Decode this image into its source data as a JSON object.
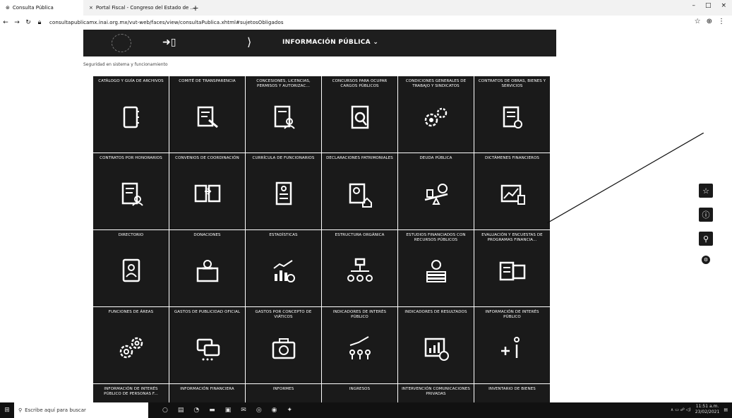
{
  "browser": {
    "tabs": [
      {
        "title": "Consulta Pública",
        "active": true
      },
      {
        "title": "Portal Fiscal - Congreso del Estado de ...",
        "active": false
      }
    ],
    "new_tab": "+",
    "url": "consultapublicamx.inai.org.mx/vut-web/faces/view/consultaPublica.xhtml#sujetosObligados",
    "window_controls": [
      "–",
      "□",
      "×"
    ],
    "address_actions": [
      "☆",
      "⊕",
      "⋮"
    ]
  },
  "site": {
    "menu_label": "INFORMACIÓN PÚBLICA ⌄",
    "breadcrumb": "Seguridad en sistema y funcionamiento"
  },
  "tiles": [
    {
      "title": "CATÁLOGO Y GUÍA DE ARCHIVOS",
      "icon": "notebook-icon"
    },
    {
      "title": "COMITÉ DE TRANSPARENCIA",
      "icon": "gavel-document-icon"
    },
    {
      "title": "CONCESIONES, LICENCIAS, PERMISOS Y AUTORIZAC...",
      "icon": "document-person-icon"
    },
    {
      "title": "CONCURSOS PARA OCUPAR CARGOS PÚBLICOS",
      "icon": "document-search-icon"
    },
    {
      "title": "CONDICIONES GENERALES DE TRABAJO Y SINDICATOS",
      "icon": "gears-people-icon"
    },
    {
      "title": "CONTRATOS DE OBRAS, BIENES Y SERVICIOS",
      "icon": "contract-check-icon"
    },
    {
      "title": "CONTRATOS POR HONORARIOS",
      "icon": "document-user-icon"
    },
    {
      "title": "CONVENIOS DE COORDINACIÓN",
      "icon": "exchange-documents-icon"
    },
    {
      "title": "CURRÍCULA DE FUNCIONARIOS",
      "icon": "resume-icon"
    },
    {
      "title": "DECLARACIONES PATRIMONIALES",
      "icon": "declaration-home-icon"
    },
    {
      "title": "DEUDA PÚBLICA",
      "icon": "balance-money-icon"
    },
    {
      "title": "DICTÁMENES FINANCIEROS",
      "icon": "financial-chart-icon"
    },
    {
      "title": "DIRECTORIO",
      "icon": "address-book-icon"
    },
    {
      "title": "DONACIONES",
      "icon": "donation-box-icon"
    },
    {
      "title": "ESTADÍSTICAS",
      "icon": "statistics-icon"
    },
    {
      "title": "ESTRUCTURA ORGÁNICA",
      "icon": "org-chart-icon"
    },
    {
      "title": "ESTUDIOS FINANCIADOS CON RECURSOS PÚBLICOS",
      "icon": "money-books-icon"
    },
    {
      "title": "EVALUACIÓN Y ENCUESTAS DE PROGRAMAS FINANCIA...",
      "icon": "survey-money-icon"
    },
    {
      "title": "FUNCIONES DE ÁREAS",
      "icon": "gears-icon"
    },
    {
      "title": "GASTOS DE PUBLICIDAD OFICIAL",
      "icon": "chat-bubbles-icon"
    },
    {
      "title": "GASTOS POR CONCEPTO DE VIÁTICOS",
      "icon": "briefcase-money-icon"
    },
    {
      "title": "INDICADORES DE INTERÉS PÚBLICO",
      "icon": "people-growth-icon"
    },
    {
      "title": "INDICADORES DE RESULTADOS",
      "icon": "results-chart-icon"
    },
    {
      "title": "INFORMACIÓN DE INTERÉS PÚBLICO",
      "icon": "info-plus-icon"
    }
  ],
  "last_row": [
    "INFORMACIÓN DE INTERÉS PÚBLICO DE PERSONAS F...",
    "INFORMACIÓN FINANCIERA",
    "INFORMES",
    "INGRESOS",
    "INTERVENCIÓN COMUNICACIONES PRIVADAS",
    "INVENTARIO DE BIENES"
  ],
  "side_tools": [
    "☆",
    "ⓘ",
    "⚲",
    "⚙"
  ],
  "taskbar": {
    "search_placeholder": "Escribe aquí para buscar",
    "time": "11:51 a.m.",
    "date": "23/02/2021"
  }
}
